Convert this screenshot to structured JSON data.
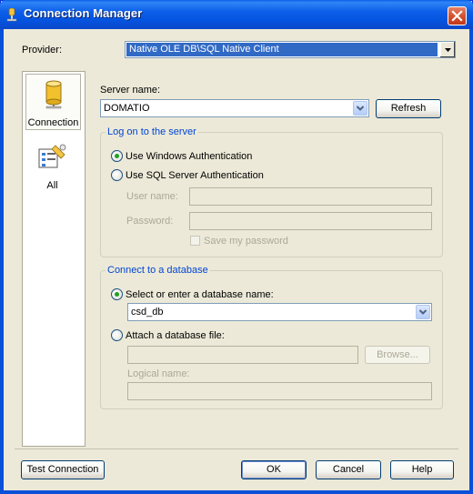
{
  "window": {
    "title": "Connection Manager"
  },
  "provider": {
    "label": "Provider:",
    "value": "Native OLE DB\\SQL Native Client"
  },
  "nav": {
    "items": [
      {
        "label": "Connection",
        "icon": "database-icon",
        "selected": true
      },
      {
        "label": "All",
        "icon": "properties-icon",
        "selected": false
      }
    ]
  },
  "server": {
    "label": "Server name:",
    "value": "DOMATIO",
    "refresh_label": "Refresh"
  },
  "logon": {
    "title": "Log on to the server",
    "windows_auth_label": "Use Windows Authentication",
    "sql_auth_label": "Use SQL Server Authentication",
    "user_name_label": "User name:",
    "password_label": "Password:",
    "save_password_label": "Save my password",
    "selected": "windows"
  },
  "database": {
    "title": "Connect to a database",
    "select_label": "Select or enter a database name:",
    "db_value": "csd_db",
    "attach_label": "Attach a database file:",
    "browse_label": "Browse...",
    "logical_name_label": "Logical name:",
    "selected": "select"
  },
  "footer": {
    "test_connection_label": "Test Connection",
    "ok_label": "OK",
    "cancel_label": "Cancel",
    "help_label": "Help"
  },
  "colors": {
    "titlebar": "#0554e0",
    "selection": "#316ac5",
    "dialog": "#ece9d8",
    "group_title": "#0046d5",
    "close": "#d4532f"
  }
}
